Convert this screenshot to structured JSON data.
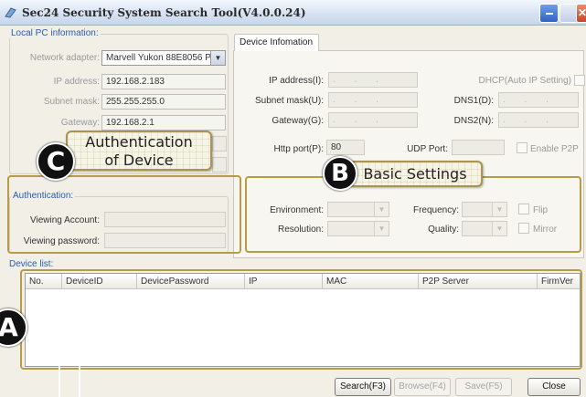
{
  "window": {
    "title": "Sec24 Security System Search Tool(V4.0.0.24)"
  },
  "local_pc": {
    "group_label": "Local PC information:",
    "network_adapter_label": "Network adapter:",
    "network_adapter_value": "Marvell Yukon 88E8056 PC",
    "ip_label": "IP address:",
    "ip_value": "192.168.2.183",
    "subnet_label": "Subnet mask:",
    "subnet_value": "255.255.255.0",
    "gateway_label": "Gateway:",
    "gateway_value": "192.168.2.1"
  },
  "auth": {
    "group_label": "Authentication:",
    "viewing_account_label": "Viewing Account:",
    "viewing_password_label": "Viewing password:"
  },
  "device_info": {
    "tab_label": "Device Infomation",
    "ip_label": "IP address(I):",
    "subnet_label": "Subnet mask(U):",
    "gateway_label": "Gateway(G):",
    "dhcp_label": "DHCP(Auto IP Setting)",
    "dns1_label": "DNS1(D):",
    "dns2_label": "DNS2(N):",
    "ip_placeholder": ".     .     .",
    "http_port_label": "Http port(P):",
    "http_port_value": "80",
    "udp_port_label": "UDP Port:",
    "enable_p2p_label": "Enable P2P",
    "environment_label": "Environment:",
    "frequency_label": "Frequency:",
    "flip_label": "Flip",
    "resolution_label": "Resolution:",
    "quality_label": "Quality:",
    "mirror_label": "Mirror"
  },
  "device_list": {
    "group_label": "Device list:",
    "columns": [
      "No.",
      "DeviceID",
      "DevicePassword",
      "IP",
      "MAC",
      "P2P Server",
      "FirmVer"
    ]
  },
  "buttons": {
    "search": "Search(F3)",
    "browse": "Browse(F4)",
    "save": "Save(F5)",
    "close": "Close"
  },
  "callouts": {
    "a_letter": "A",
    "b_letter": "B",
    "b_text": "Basic Settings",
    "c_letter": "C",
    "c_line1": "Authentication",
    "c_line2": "of Device"
  },
  "colors": {
    "group_label": "#2a5cae",
    "highlight": "#b89b46",
    "titlebar": "#c6d6ec"
  }
}
